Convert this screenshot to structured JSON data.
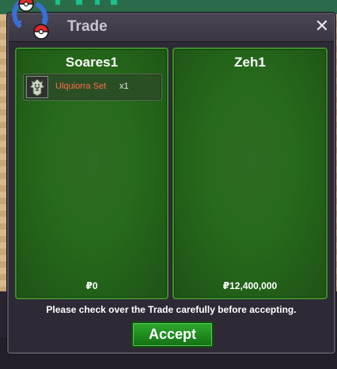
{
  "window": {
    "title": "Trade",
    "close_icon": "close-icon"
  },
  "offers": [
    {
      "player": "Soares1",
      "items": [
        {
          "name": "Ulquiorra Set",
          "quantity": "x1",
          "icon": "armor-set-icon"
        }
      ],
      "money": "₽0"
    },
    {
      "player": "Zeh1",
      "items": [],
      "money": "₽12,400,000"
    }
  ],
  "footer": {
    "notice": "Please check over the Trade carefully before accepting.",
    "accept_label": "Accept"
  },
  "colors": {
    "panel_green": "#276a1c",
    "item_name": "#ff6b4a",
    "accept_button": "#1f8a1f",
    "window_bg": "#2e2a35"
  }
}
